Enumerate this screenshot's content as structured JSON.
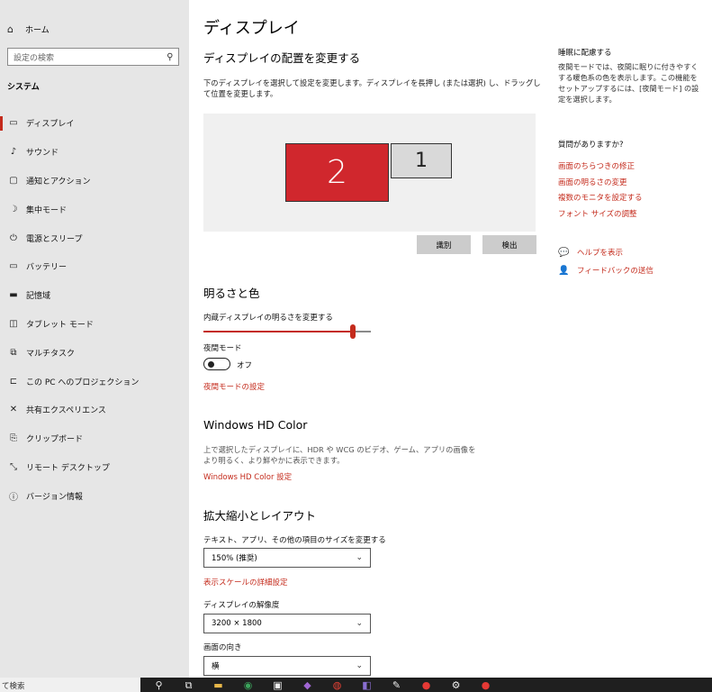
{
  "sidebar": {
    "home_label": "ホーム",
    "search_placeholder": "設定の検索",
    "section_heading": "システム",
    "items": [
      {
        "label": "ディスプレイ",
        "icon": "monitor-icon",
        "active": true
      },
      {
        "label": "サウンド",
        "icon": "speaker-icon"
      },
      {
        "label": "通知とアクション",
        "icon": "notification-icon"
      },
      {
        "label": "集中モード",
        "icon": "moon-icon"
      },
      {
        "label": "電源とスリープ",
        "icon": "power-icon"
      },
      {
        "label": "バッテリー",
        "icon": "battery-icon"
      },
      {
        "label": "記憶域",
        "icon": "storage-icon"
      },
      {
        "label": "タブレット モード",
        "icon": "tablet-icon"
      },
      {
        "label": "マルチタスク",
        "icon": "multitask-icon"
      },
      {
        "label": "この PC へのプロジェクション",
        "icon": "projection-icon"
      },
      {
        "label": "共有エクスペリエンス",
        "icon": "shared-experience-icon"
      },
      {
        "label": "クリップボード",
        "icon": "clipboard-icon"
      },
      {
        "label": "リモート デスクトップ",
        "icon": "remote-desktop-icon"
      },
      {
        "label": "バージョン情報",
        "icon": "info-icon"
      }
    ]
  },
  "main": {
    "title": "ディスプレイ",
    "arrange": {
      "heading": "ディスプレイの配置を変更する",
      "description": "下のディスプレイを選択して設定を変更します。ディスプレイを長押し (または選択) し、ドラッグして位置を変更します。",
      "monitor_primary": "2",
      "monitor_secondary": "1",
      "identify_label": "識別",
      "detect_label": "検出"
    },
    "brightness": {
      "heading": "明るさと色",
      "slider_label": "内蔵ディスプレイの明るさを変更する",
      "slider_value": 0.89,
      "night_label": "夜間モード",
      "night_state": "オフ",
      "night_link": "夜間モードの設定"
    },
    "hdr": {
      "heading": "Windows HD Color",
      "description": "上で選択したディスプレイに、HDR や WCG のビデオ、ゲーム、アプリの画像をより明るく、より鮮やかに表示できます。",
      "link": "Windows HD Color 設定"
    },
    "scale": {
      "heading": "拡大縮小とレイアウト",
      "size_label": "テキスト、アプリ、その他の項目のサイズを変更する",
      "size_value": "150% (推奨)",
      "advanced_link": "表示スケールの詳細設定",
      "resolution_label": "ディスプレイの解像度",
      "resolution_value": "3200 × 1800",
      "orientation_label": "画面の向き",
      "orientation_value": "横"
    }
  },
  "right": {
    "sleep_heading": "睡眠に配慮する",
    "sleep_desc": "夜間モードでは、夜間に眠りに付きやすくする暖色系の色を表示します。この機能をセットアップするには、[夜間モード] の設定を選択します。",
    "question_heading": "質問がありますか?",
    "links": [
      "画面のちらつきの修正",
      "画面の明るさの変更",
      "複数のモニタを設定する",
      "フォント サイズの調整"
    ],
    "help_label": "ヘルプを表示",
    "feedback_label": "フィードバックの送信"
  },
  "taskbar": {
    "search_text": "て検索",
    "icons": [
      "search-icon",
      "task-view-icon",
      "folder-icon",
      "edge-icon",
      "store-icon",
      "app-icon",
      "chrome-icon",
      "vs-icon",
      "pen-icon",
      "record-icon",
      "gear-icon",
      "record-icon"
    ]
  },
  "colors": {
    "accent": "#c42b1c",
    "sidebar_bg": "#e6e6e6",
    "monitor_selected": "#d0272d"
  }
}
